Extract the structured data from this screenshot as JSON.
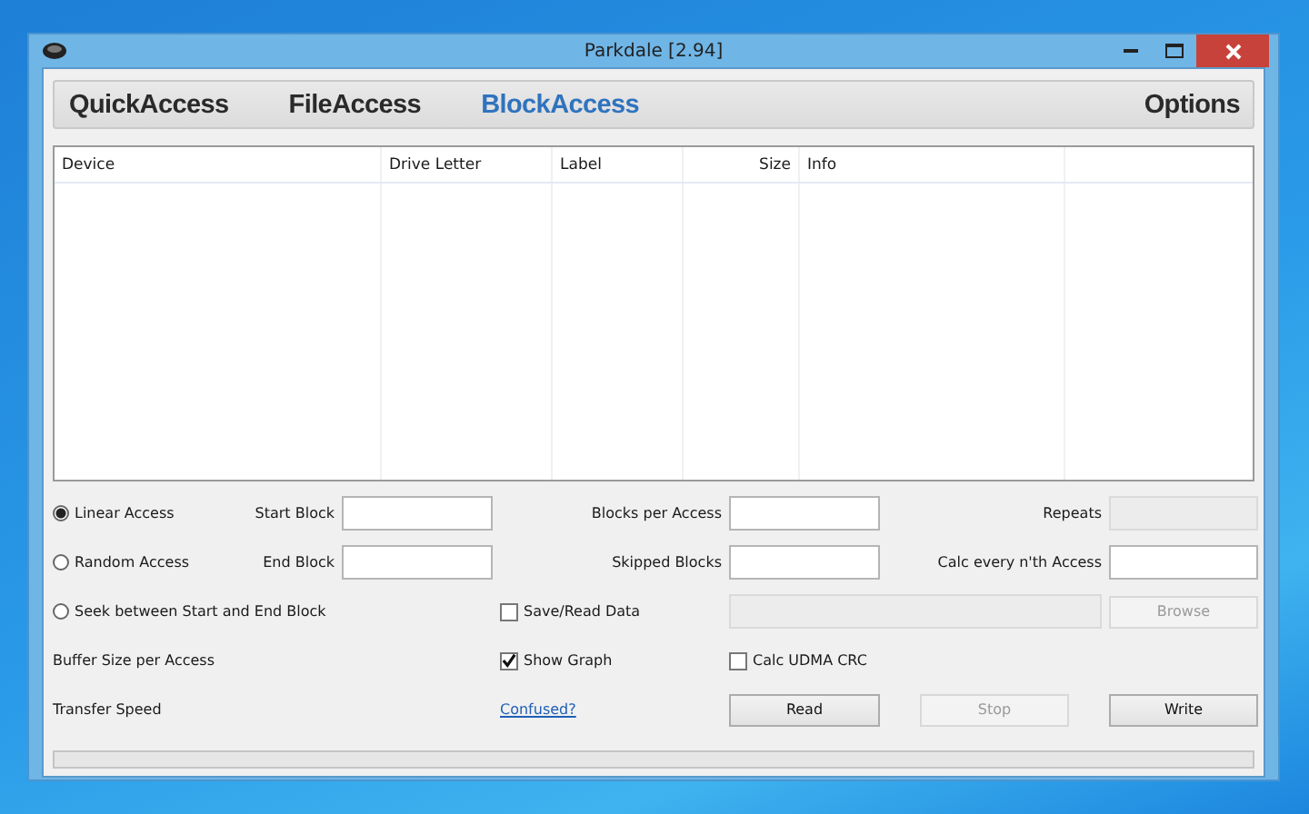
{
  "window": {
    "title": "Parkdale [2.94]"
  },
  "tabs": [
    {
      "label": "QuickAccess",
      "selected": false
    },
    {
      "label": "FileAccess",
      "selected": false
    },
    {
      "label": "BlockAccess",
      "selected": true
    },
    {
      "label": "Options",
      "selected": false
    }
  ],
  "table": {
    "columns": [
      "Device",
      "Drive Letter",
      "Label",
      "Size",
      "Info"
    ]
  },
  "access_modes": [
    {
      "label": "Linear Access",
      "selected": true
    },
    {
      "label": "Random Access",
      "selected": false
    },
    {
      "label": "Seek between Start and End Block",
      "selected": false
    }
  ],
  "fields": [
    {
      "label": "Start Block",
      "disabled": false
    },
    {
      "label": "Blocks per Access",
      "disabled": false
    },
    {
      "label": "Repeats",
      "disabled": true
    },
    {
      "label": "End Block",
      "disabled": false
    },
    {
      "label": "Skipped Blocks",
      "disabled": false
    },
    {
      "label": "Calc every n'th Access",
      "disabled": false
    }
  ],
  "checkboxes": [
    {
      "label": "Save/Read Data",
      "checked": false
    },
    {
      "label": "Show Graph",
      "checked": true
    },
    {
      "label": "Calc UDMA CRC",
      "checked": false
    }
  ],
  "file_path": {
    "disabled": true
  },
  "browse_button": {
    "label": "Browse",
    "disabled": true
  },
  "buffer_size_label": "Buffer Size per Access",
  "transfer_speed_label": "Transfer Speed",
  "help_link": "Confused?",
  "buttons": [
    {
      "label": "Read",
      "disabled": false
    },
    {
      "label": "Stop",
      "disabled": true
    },
    {
      "label": "Write",
      "disabled": false
    }
  ],
  "progress": {
    "level": 0
  }
}
